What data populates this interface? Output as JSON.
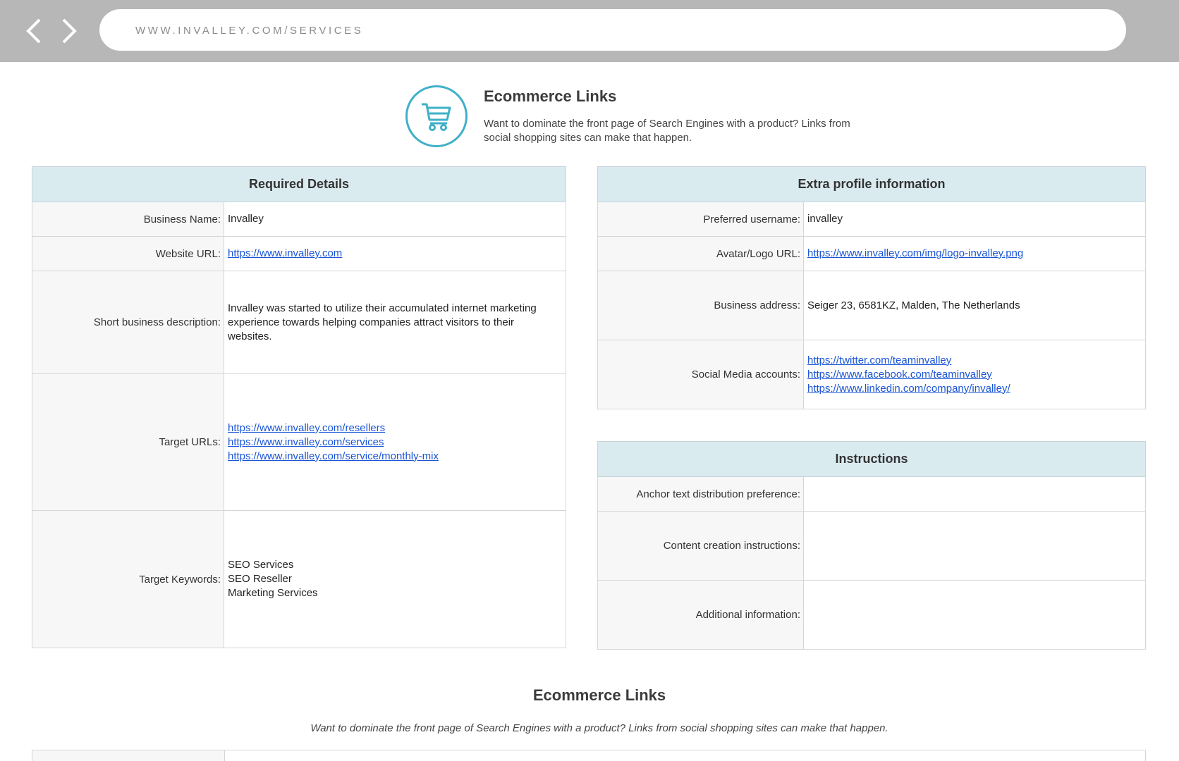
{
  "browser": {
    "url": "WWW.INVALLEY.COM/SERVICES",
    "back_icon": "chevron-left-icon",
    "forward_icon": "chevron-right-icon"
  },
  "header": {
    "icon": "shopping-cart-icon",
    "accent_color": "#3fb0c8",
    "title": "Ecommerce Links",
    "description": "Want to dominate the front page of Search Engines with a product? Links from social shopping sites can make that happen."
  },
  "required": {
    "heading": "Required Details",
    "business_name_label": "Business Name:",
    "business_name": "Invalley",
    "website_label": "Website URL:",
    "website": "https://www.invalley.com",
    "short_desc_label": "Short business description:",
    "short_desc": "Invalley was started to utilize their accumulated internet marketing experience towards helping companies attract visitors to their websites.",
    "target_urls_label": "Target URLs:",
    "target_urls": [
      "https://www.invalley.com/resellers",
      "https://www.invalley.com/services",
      "https://www.invalley.com/service/monthly-mix"
    ],
    "target_keywords_label": "Target Keywords:",
    "target_keywords": [
      "SEO Services",
      "SEO Reseller",
      "Marketing Services"
    ]
  },
  "extra": {
    "heading": "Extra profile information",
    "username_label": "Preferred username:",
    "username": "invalley",
    "avatar_label": "Avatar/Logo URL:",
    "avatar": "https://www.invalley.com/img/logo-invalley.png",
    "address_label": "Business address:",
    "address": "Seiger 23, 6581KZ, Malden, The Netherlands",
    "social_label": "Social Media accounts:",
    "social": [
      "https://twitter.com/teaminvalley",
      "https://www.facebook.com/teaminvalley",
      "https://www.linkedin.com/company/invalley/"
    ]
  },
  "instructions": {
    "heading": "Instructions",
    "anchor_label": "Anchor text distribution preference:",
    "anchor_value": "",
    "content_label": "Content creation instructions:",
    "content_value": "",
    "additional_label": "Additional information:",
    "additional_value": ""
  },
  "footer_section": {
    "title": "Ecommerce Links",
    "subtitle": "Want to dominate the front page of Search Engines with a product? Links from social shopping sites can make that happen."
  }
}
